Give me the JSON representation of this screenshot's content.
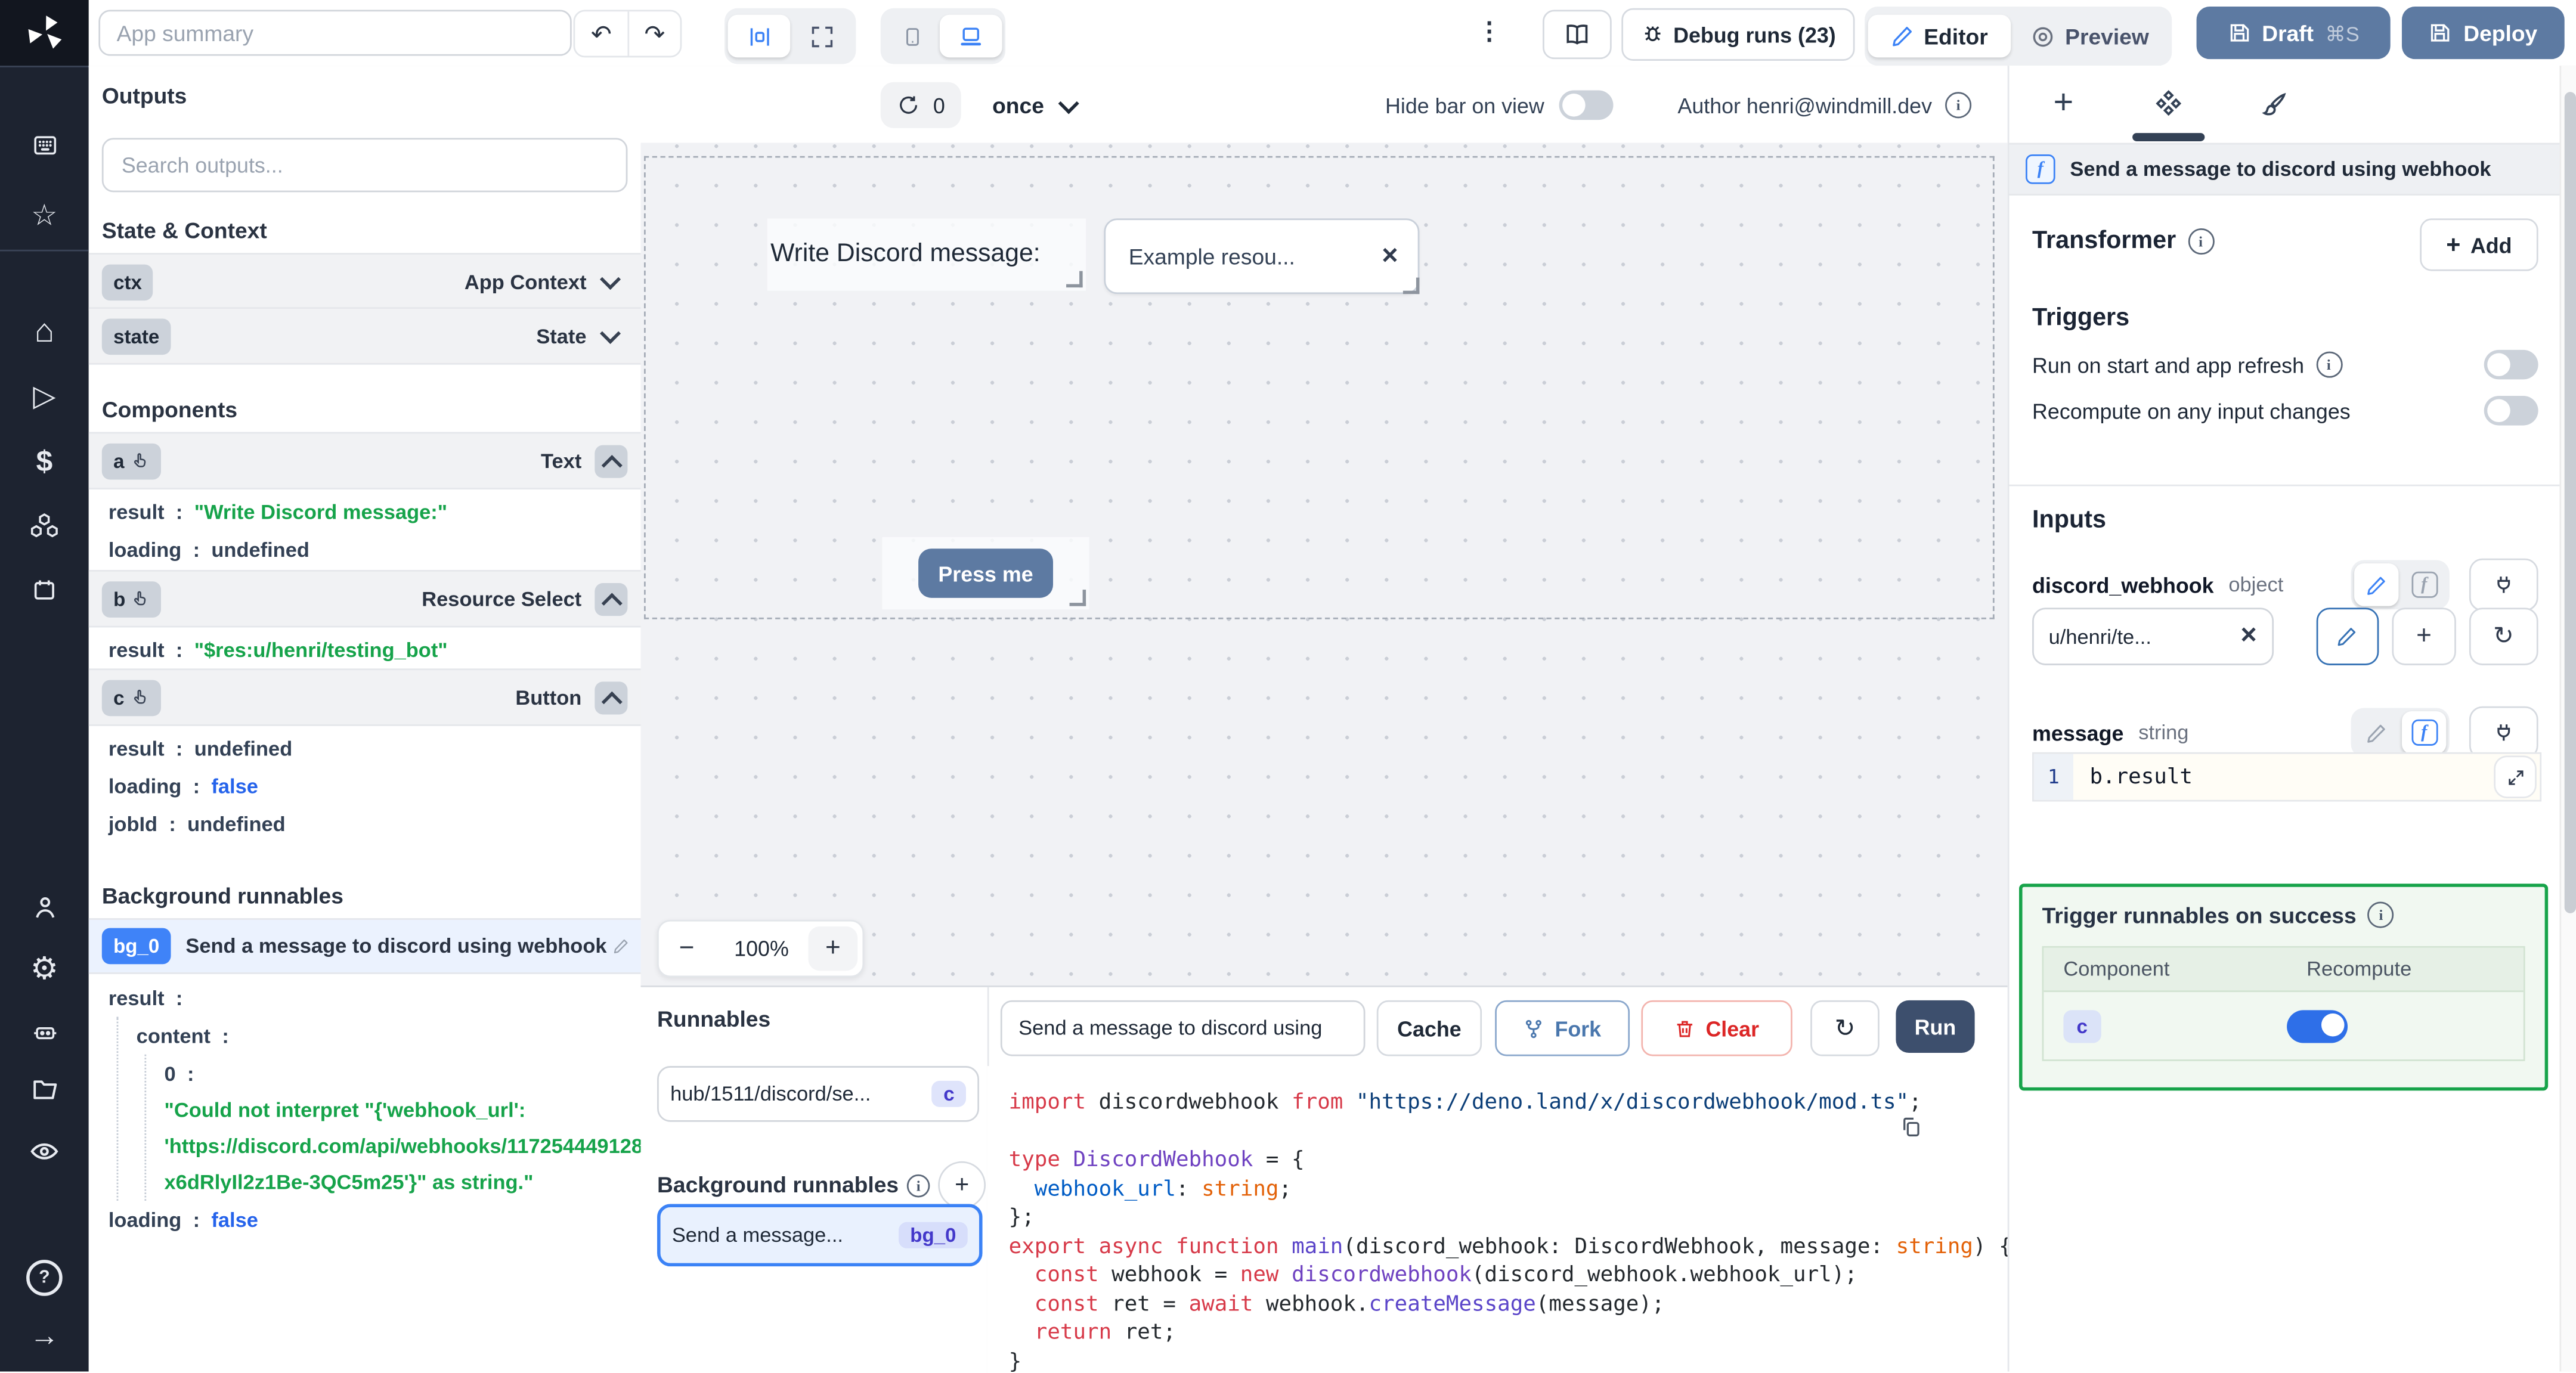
{
  "topbar": {
    "app_summary_placeholder": "App summary",
    "debug_runs_label": "Debug runs (23)",
    "editor_label": "Editor",
    "preview_label": "Preview",
    "draft_label": "Draft",
    "draft_shortcut": "⌘S",
    "deploy_label": "Deploy"
  },
  "outputs_panel": {
    "title": "Outputs",
    "search_placeholder": "Search outputs...",
    "state_context": {
      "title": "State & Context",
      "rows": [
        {
          "badge": "ctx",
          "label": "App Context"
        },
        {
          "badge": "state",
          "label": "State"
        }
      ]
    },
    "components": {
      "title": "Components",
      "items": [
        {
          "badge": "a",
          "type": "Text",
          "kv": [
            {
              "k": "result",
              "v": "\"Write Discord message:\""
            },
            {
              "k": "loading",
              "v": "undefined"
            }
          ]
        },
        {
          "badge": "b",
          "type": "Resource Select",
          "kv": [
            {
              "k": "result",
              "v": "\"$res:u/henri/testing_bot\""
            }
          ]
        },
        {
          "badge": "c",
          "type": "Button",
          "kv": [
            {
              "k": "result",
              "v": "undefined"
            },
            {
              "k": "loading",
              "v": "false"
            },
            {
              "k": "jobId",
              "v": "undefined"
            }
          ]
        }
      ]
    },
    "background": {
      "title": "Background runnables",
      "badge": "bg_0",
      "name": "Send a message to discord using webhook",
      "tree": {
        "result_key": "result",
        "content_key": "content",
        "index_key": "0",
        "error_lines": [
          "\"Could not interpret \"{'webhook_url':",
          "'https://discord.com/api/webhooks/117254449128",
          "x6dRlyIl2z1Be-3QC5m25'}\" as string.\""
        ],
        "loading_key": "loading",
        "loading_value": "false"
      }
    }
  },
  "center": {
    "toolbar": {
      "refresh_count": "0",
      "run_mode": "once",
      "hide_bar_label": "Hide bar on view",
      "author_label": "Author henri@windmill.dev"
    },
    "canvas": {
      "text_component": "Write Discord message:",
      "resource_select_value": "Example resou...",
      "button_label": "Press me",
      "zoom_value": "100%"
    }
  },
  "runnables_panel": {
    "title": "Runnables",
    "item": {
      "name": "hub/1511/discord/se...",
      "badge": "c"
    },
    "background_title": "Background runnables",
    "background_item": {
      "name": "Send a message...",
      "badge": "bg_0"
    }
  },
  "code_panel": {
    "name_value": "Send a message to discord using",
    "cache_label": "Cache",
    "fork_label": "Fork",
    "clear_label": "Clear",
    "run_label": "Run",
    "lines": [
      [
        [
          "kw",
          "import"
        ],
        [
          "pl",
          " discordwebhook "
        ],
        [
          "kw",
          "from"
        ],
        [
          "str",
          " \"https://deno.land/x/discordwebhook/mod.ts\""
        ],
        [
          "pl",
          ";"
        ]
      ],
      [],
      [
        [
          "kw",
          "type"
        ],
        [
          "pl",
          " "
        ],
        [
          "ent",
          "DiscordWebhook"
        ],
        [
          "pl",
          " = {"
        ]
      ],
      [
        [
          "pl",
          "  "
        ],
        [
          "vr",
          "webhook_url"
        ],
        [
          "pl",
          ": "
        ],
        [
          "typ",
          "string"
        ],
        [
          "pl",
          ";"
        ]
      ],
      [
        [
          "pl",
          "};"
        ]
      ],
      [
        [
          "kw",
          "export"
        ],
        [
          "pl",
          " "
        ],
        [
          "kw",
          "async"
        ],
        [
          "pl",
          " "
        ],
        [
          "kw",
          "function"
        ],
        [
          "pl",
          " "
        ],
        [
          "fn",
          "main"
        ],
        [
          "pl",
          "(discord_webhook: DiscordWebhook, message: "
        ],
        [
          "typ",
          "string"
        ],
        [
          "pl",
          ") {"
        ]
      ],
      [
        [
          "pl",
          "  "
        ],
        [
          "kw",
          "const"
        ],
        [
          "pl",
          " webhook = "
        ],
        [
          "kw",
          "new"
        ],
        [
          "pl",
          " "
        ],
        [
          "ent",
          "discordwebhook"
        ],
        [
          "pl",
          "(discord_webhook.webhook_url);"
        ]
      ],
      [
        [
          "pl",
          "  "
        ],
        [
          "kw",
          "const"
        ],
        [
          "pl",
          " ret = "
        ],
        [
          "kw",
          "await"
        ],
        [
          "pl",
          " webhook."
        ],
        [
          "fn",
          "createMessage"
        ],
        [
          "pl",
          "(message);"
        ]
      ],
      [
        [
          "pl",
          "  "
        ],
        [
          "kw",
          "return"
        ],
        [
          "pl",
          " ret;"
        ]
      ],
      [
        [
          "pl",
          "}"
        ]
      ]
    ]
  },
  "right_panel": {
    "header": "Send a message to discord using webhook",
    "transformer": {
      "title": "Transformer",
      "add_label": "Add"
    },
    "triggers": {
      "title": "Triggers",
      "rows": [
        {
          "label": "Run on start and app refresh"
        },
        {
          "label": "Recompute on any input changes"
        }
      ]
    },
    "inputs": {
      "title": "Inputs",
      "fields": [
        {
          "name": "discord_webhook",
          "type": "object",
          "value": "u/henri/te..."
        },
        {
          "name": "message",
          "type": "string",
          "line_no": "1",
          "expr": "b.result"
        }
      ]
    },
    "success": {
      "title": "Trigger runnables on success",
      "columns": [
        "Component",
        "Recompute"
      ],
      "rows": [
        {
          "component": "c",
          "recompute": true
        }
      ]
    }
  },
  "colors": {
    "accent_blue": "#3b82f6",
    "steel_blue": "#5d7aa2",
    "run_navy": "#3d4f6d",
    "success_green": "#17a34a",
    "string_green": "#16a34a",
    "bool_blue": "#2563eb"
  }
}
